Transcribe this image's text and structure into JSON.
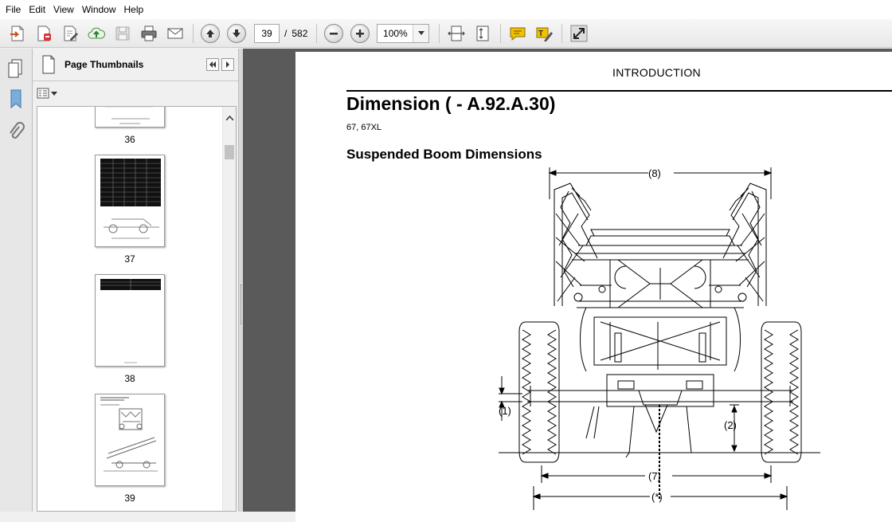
{
  "menu": [
    "File",
    "Edit",
    "View",
    "Window",
    "Help"
  ],
  "toolbar": {
    "buttons": [
      "create-pdf-icon",
      "convert-icon",
      "edit-icon",
      "upload-icon",
      "save-icon",
      "print-icon",
      "email-icon"
    ],
    "page_current": "39",
    "page_separator": "/",
    "page_total": "582",
    "zoom": "100%"
  },
  "panel": {
    "title": "Page Thumbnails",
    "thumbnails": [
      {
        "label": "36"
      },
      {
        "label": "37"
      },
      {
        "label": "38"
      },
      {
        "label": "39"
      }
    ]
  },
  "document": {
    "header": "INTRODUCTION",
    "title": "Dimension ( - A.92.A.30)",
    "models": "67, 67XL",
    "subtitle": "Suspended Boom Dimensions",
    "dimension_labels": [
      "(8)",
      "(1)",
      "(2)",
      "(7)",
      "(*)"
    ]
  },
  "colors": {
    "doc_background": "#5a5a5a",
    "panel_background": "#f0f0f0",
    "comment_icon": "#f2c100"
  }
}
